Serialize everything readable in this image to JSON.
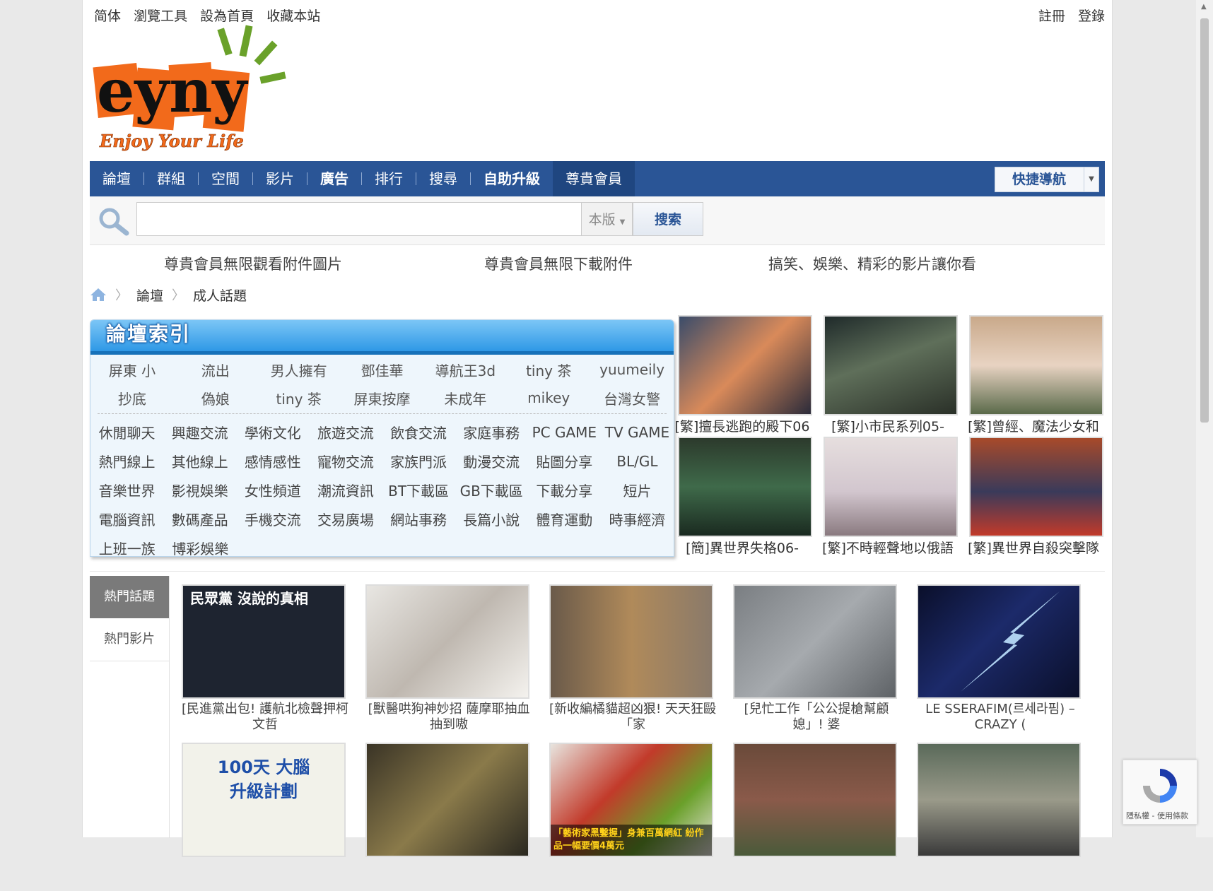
{
  "topbar": {
    "left": [
      "简体",
      "瀏覽工具",
      "設為首頁",
      "收藏本站"
    ],
    "right": [
      "註冊",
      "登錄"
    ]
  },
  "logo": {
    "main": "eyny",
    "tagline": "Enjoy Your Life"
  },
  "nav": {
    "items": [
      {
        "label": "論壇",
        "bold": false
      },
      {
        "label": "群組",
        "bold": false
      },
      {
        "label": "空間",
        "bold": false
      },
      {
        "label": "影片",
        "bold": false
      },
      {
        "label": "廣告",
        "bold": true
      },
      {
        "label": "排行",
        "bold": false
      },
      {
        "label": "搜尋",
        "bold": false
      },
      {
        "label": "自助升級",
        "bold": true
      },
      {
        "label": "尊貴會員",
        "bold": false
      }
    ],
    "quick_nav": "快捷導航"
  },
  "search": {
    "value": "",
    "placeholder": "",
    "scope": "本版",
    "button": "搜索"
  },
  "promo": [
    "尊貴會員無限觀看附件圖片",
    "尊貴會員無限下載附件",
    "搞笑、娛樂、精彩的影片讓你看"
  ],
  "breadcrumb": [
    "論壇",
    "成人話題"
  ],
  "forum_index": {
    "title": "論壇索引",
    "keywords": [
      [
        "屏東 小",
        "流出",
        "男人擁有",
        "鄧佳華",
        "導航王3d",
        "tiny 茶",
        "yuumeily"
      ],
      [
        "抄底",
        "偽娘",
        "tiny 茶",
        "屏東按摩",
        "未成年",
        "mikey",
        "台灣女警"
      ]
    ],
    "forums": [
      [
        "休閒聊天",
        "興趣交流",
        "學術文化",
        "旅遊交流",
        "飲食交流",
        "家庭事務",
        "PC GAME",
        "TV GAME"
      ],
      [
        "熱門線上",
        "其他線上",
        "感情感性",
        "寵物交流",
        "家族門派",
        "動漫交流",
        "貼圖分享",
        "BL/GL"
      ],
      [
        "音樂世界",
        "影視娛樂",
        "女性頻道",
        "潮流資訊",
        "BT下載區",
        "GB下載區",
        "下載分享",
        "短片"
      ],
      [
        "電腦資訊",
        "數碼產品",
        "手機交流",
        "交易廣場",
        "網站事務",
        "長篇小說",
        "體育運動",
        "時事經濟"
      ],
      [
        "上班一族",
        "博彩娛樂"
      ]
    ]
  },
  "anime_thumbs": [
    {
      "caption": "[繁]擅長逃跑的殿下06"
    },
    {
      "caption": "[繁]小市民系列05-"
    },
    {
      "caption": "[繁]曾經、魔法少女和"
    },
    {
      "caption": "[簡]異世界失格06-"
    },
    {
      "caption": "[繁]不時輕聲地以俄語"
    },
    {
      "caption": "[繁]異世界自殺突擊隊"
    }
  ],
  "hot": {
    "tabs": [
      "熱門話題",
      "熱門影片"
    ],
    "cards": [
      {
        "caption": "[民進黨出包!  護航北檢聲押柯文哲",
        "overlay": "民眾黨 沒說的真相"
      },
      {
        "caption": "[獸醫哄狗神妙招 薩摩耶抽血抽到嗷",
        "overlay": ""
      },
      {
        "caption": "[新收編橘貓超凶狠! 天天狂毆「家",
        "overlay": ""
      },
      {
        "caption": "[兒忙工作「公公提槍幫顧媳」! 婆",
        "overlay": ""
      },
      {
        "caption": "LE SSERAFIM(르세라핌) – CRAZY (",
        "overlay": ""
      },
      {
        "caption": "",
        "overlay": "100天 大腦升級計劃"
      },
      {
        "caption": "",
        "overlay": ""
      },
      {
        "caption": "",
        "overlay": "「藝術家黑鑿握」身兼百萬網紅 紛作品一幅要價4萬元"
      },
      {
        "caption": "",
        "overlay": ""
      },
      {
        "caption": "",
        "overlay": ""
      }
    ]
  },
  "recaptcha": {
    "text": "隱私權 - 使用條款"
  },
  "colors": {
    "nav_bg": "#2a5596",
    "accent": "#2a5596",
    "index_head": "#2e98e6"
  }
}
